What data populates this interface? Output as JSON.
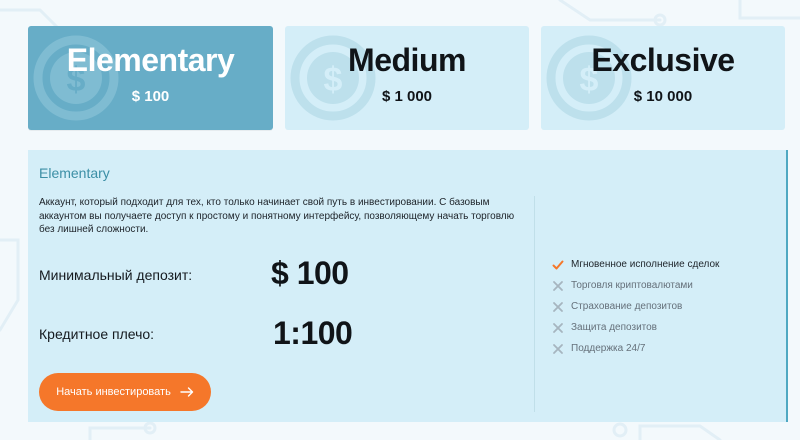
{
  "accent_colors": {
    "active_tab": "#67adc7",
    "panel": "#d4eef8",
    "cta": "#f5772a",
    "title": "#3c8fa6",
    "check": "#f5772a",
    "cross": "#a6b5bf"
  },
  "plans": [
    {
      "name": "Elementary",
      "price": "$ 100",
      "active": true,
      "icon": "dollar-coin-icon"
    },
    {
      "name": "Medium",
      "price": "$ 1 000",
      "active": false,
      "icon": "dollar-coin-icon"
    },
    {
      "name": "Exclusive",
      "price": "$ 10 000",
      "active": false,
      "icon": "dollar-coin-icon"
    }
  ],
  "detail": {
    "title": "Elementary",
    "description": "Аккаунт, который подходит для тех, кто только начинает свой путь в инвестировании. С базовым аккаунтом вы получаете доступ к простому и понятному интерфейсу, позволяющему начать торговлю без лишней сложности.",
    "min_deposit_label": "Минимальный депозит:",
    "min_deposit_value": "$ 100",
    "leverage_label": "Кредитное плечо:",
    "leverage_value": "1:100",
    "cta_label": "Начать инвестировать",
    "cta_icon": "arrow-right-icon",
    "features": [
      {
        "label": "Мгновенное исполнение сделок",
        "included": true,
        "icon": "check-icon"
      },
      {
        "label": "Торговля криптовалютами",
        "included": false,
        "icon": "cross-icon"
      },
      {
        "label": "Страхование депозитов",
        "included": false,
        "icon": "cross-icon"
      },
      {
        "label": "Защита депозитов",
        "included": false,
        "icon": "cross-icon"
      },
      {
        "label": "Поддержка 24/7",
        "included": false,
        "icon": "cross-icon"
      }
    ]
  }
}
